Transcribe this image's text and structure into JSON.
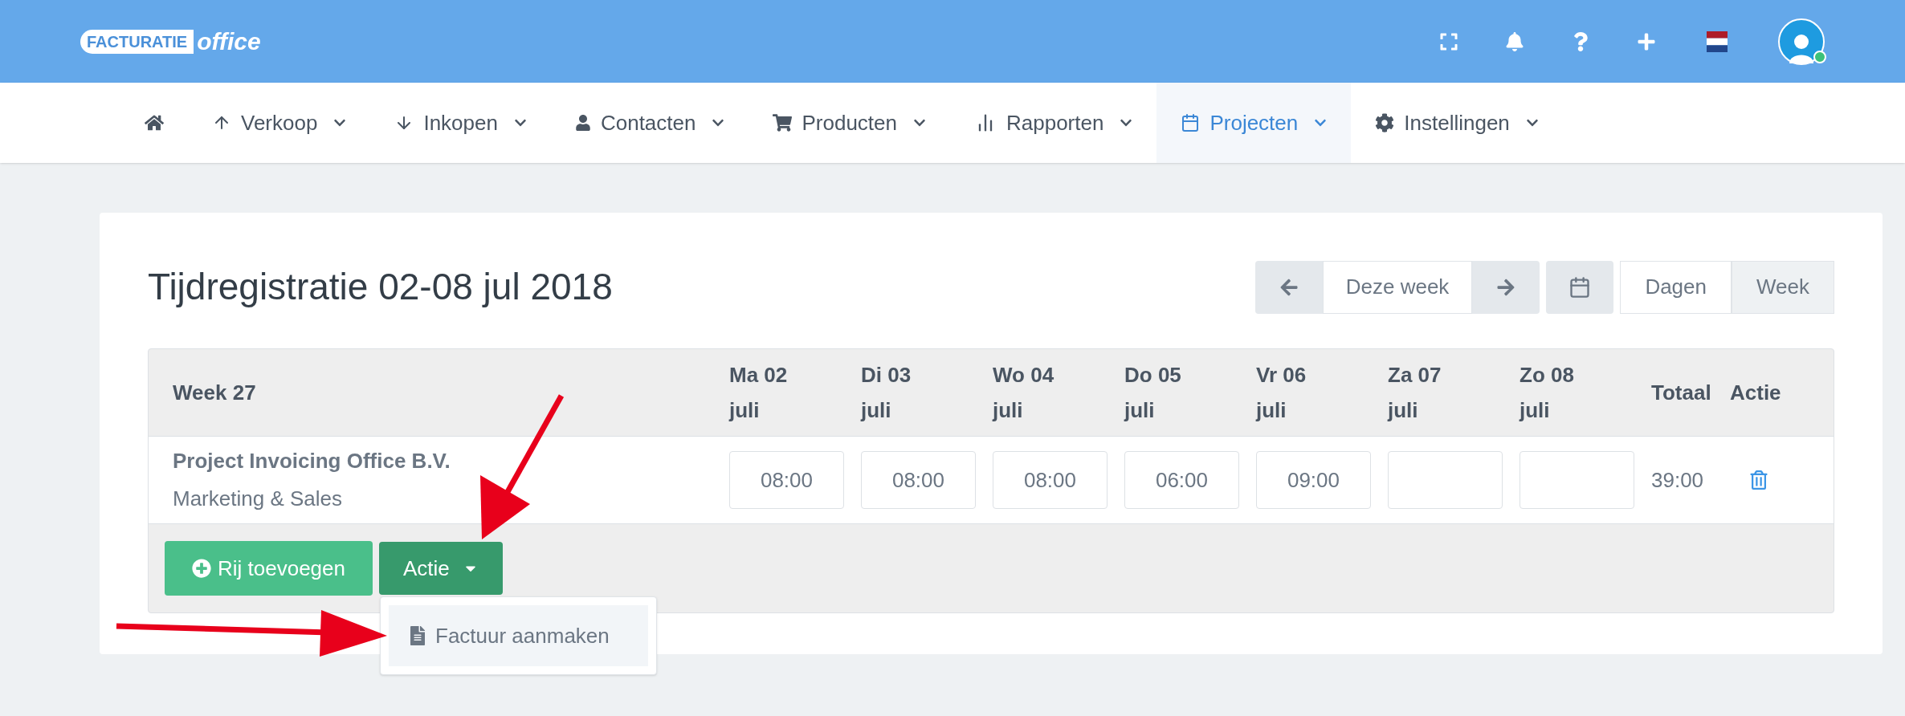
{
  "header": {
    "logo": {
      "word_1": "FACTURATIE",
      "word_2": "office"
    }
  },
  "nav": [
    {
      "kind": "home",
      "selected": false
    },
    {
      "kind": "up",
      "label": "Verkoop",
      "selected": false
    },
    {
      "kind": "down",
      "label": "Inkopen",
      "selected": false
    },
    {
      "kind": "user",
      "label": "Contacten",
      "selected": false
    },
    {
      "kind": "cart",
      "label": "Producten",
      "selected": false
    },
    {
      "kind": "chart",
      "label": "Rapporten",
      "selected": false
    },
    {
      "kind": "calendar",
      "label": "Projecten",
      "selected": true
    },
    {
      "kind": "gear",
      "label": "Instellingen",
      "selected": false
    }
  ],
  "title": "Tijdregistratie 02-08 jul 2018",
  "toolbar": {
    "current": "Deze week",
    "views": [
      {
        "label": "Dagen",
        "selected": false
      },
      {
        "label": "Week",
        "selected": true
      }
    ]
  },
  "table": {
    "first_column": "Week 27",
    "days": [
      {
        "day": "Ma 02",
        "month": "juli"
      },
      {
        "day": "Di 03",
        "month": "juli"
      },
      {
        "day": "Wo 04",
        "month": "juli"
      },
      {
        "day": "Do 05",
        "month": "juli"
      },
      {
        "day": "Vr 06",
        "month": "juli"
      },
      {
        "day": "Za 07",
        "month": "juli"
      },
      {
        "day": "Zo 08",
        "month": "juli"
      }
    ],
    "total_column": "Totaal",
    "action_column": "Actie",
    "rows": [
      {
        "project": "Project Invoicing Office B.V.",
        "task": "Marketing & Sales",
        "hours": [
          "08:00",
          "08:00",
          "08:00",
          "06:00",
          "09:00"
        ],
        "total": "39:00"
      }
    ]
  },
  "buttons": {
    "add_row": "Rij toevoegen",
    "action": "Actie"
  },
  "action_menu": {
    "expanded": true,
    "items": [
      "Factuur aanmaken"
    ]
  }
}
